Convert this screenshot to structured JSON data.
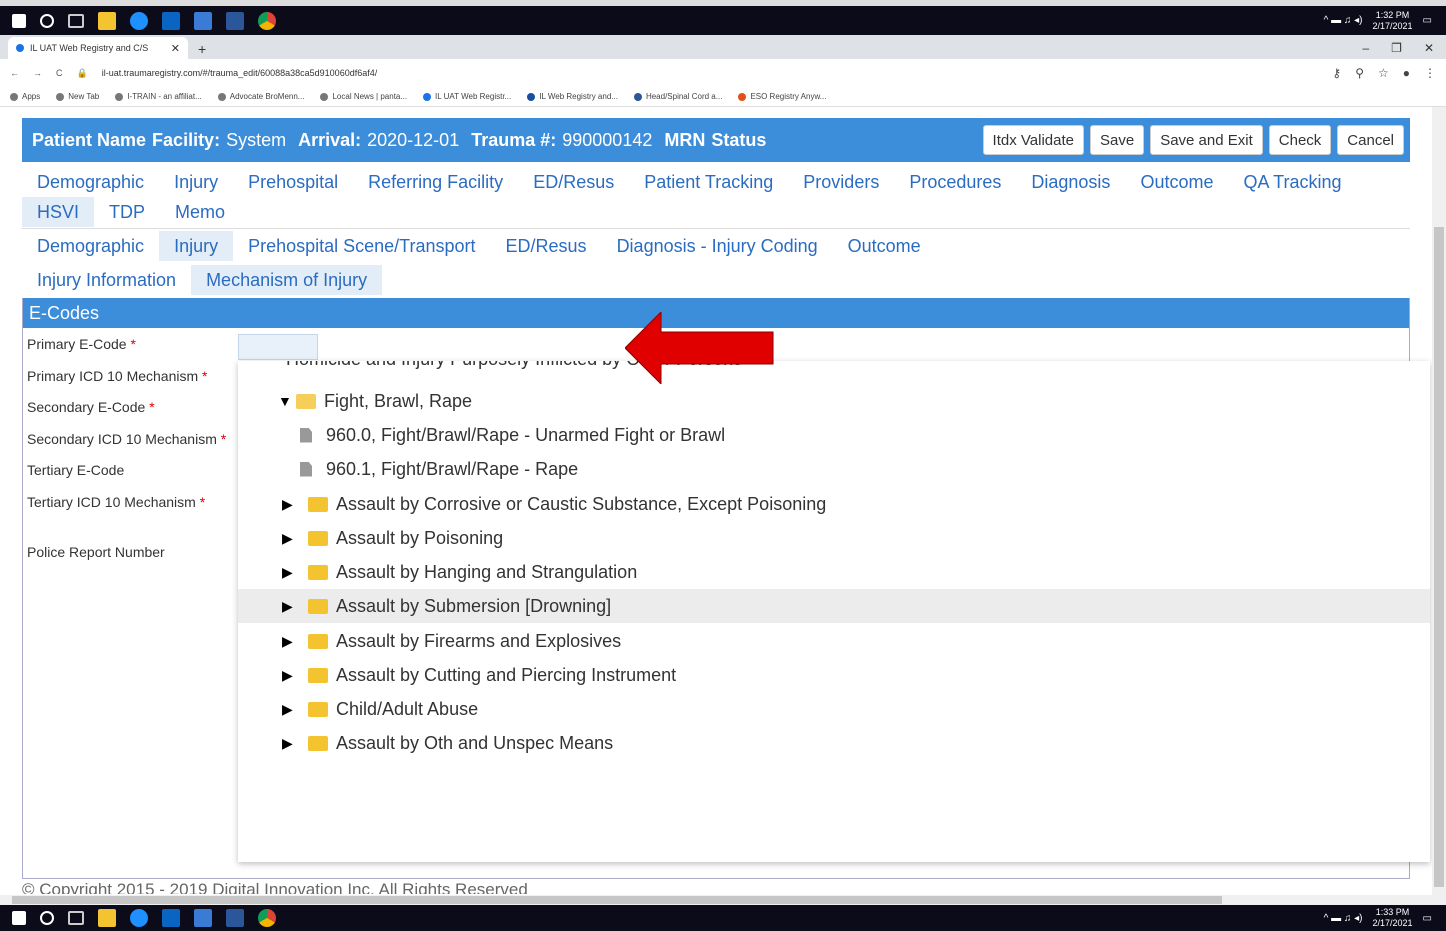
{
  "taskbar_top": {
    "time": "1:32 PM",
    "date": "2/17/2021"
  },
  "taskbar_bottom": {
    "time": "1:33 PM",
    "date": "2/17/2021"
  },
  "browser": {
    "tab_title": "IL UAT Web Registry and C/S",
    "url": "il-uat.traumaregistry.com/#/trauma_edit/60088a38ca5d910060df6af4/",
    "bookmarks": [
      "Apps",
      "New Tab",
      "I-TRAIN - an affiliat...",
      "Advocate BroMenn...",
      "Local News | panta...",
      "IL UAT Web Registr...",
      "IL Web Registry and...",
      "Head/Spinal Cord a...",
      "ESO Registry Anyw..."
    ]
  },
  "header": {
    "patient_name_label": "Patient Name",
    "facility_label": "Facility:",
    "facility_value": "System",
    "arrival_label": "Arrival:",
    "arrival_value": "2020-12-01",
    "trauma_label": "Trauma #:",
    "trauma_value": "990000142",
    "mrn_label": "MRN",
    "status_label": "Status",
    "buttons": [
      "Itdx Validate",
      "Save",
      "Save and Exit",
      "Check",
      "Cancel"
    ]
  },
  "nav1": {
    "row1": [
      "Demographic",
      "Injury",
      "Prehospital",
      "Referring Facility",
      "ED/Resus",
      "Patient Tracking",
      "Providers",
      "Procedures",
      "Diagnosis",
      "Outcome",
      "QA Tracking"
    ],
    "row2": [
      "HSVI",
      "TDP",
      "Memo"
    ]
  },
  "nav2": {
    "row1": [
      "Demographic",
      "Injury",
      "Prehospital Scene/Transport",
      "ED/Resus",
      "Diagnosis - Injury Coding",
      "Outcome"
    ],
    "row2": [
      "Injury Information",
      "Mechanism of Injury"
    ]
  },
  "ecodes": {
    "title": "E-Codes",
    "fields": [
      "Primary E-Code",
      "Primary ICD 10 Mechanism",
      "Secondary E-Code",
      "Secondary ICD 10 Mechanism",
      "Tertiary E-Code",
      "Tertiary ICD 10 Mechanism",
      "Police Report Number"
    ],
    "required_marker": "*"
  },
  "dropdown": {
    "cut_item": "Homicide and Injury Purposely Inflicted by Other Persons",
    "items": [
      "Fight, Brawl, Rape",
      "960.0, Fight/Brawl/Rape - Unarmed Fight or Brawl",
      "960.1, Fight/Brawl/Rape - Rape",
      "Assault by Corrosive or Caustic Substance, Except Poisoning",
      "Assault by Poisoning",
      "Assault by Hanging and Strangulation",
      "Assault by Submersion [Drowning]",
      "Assault by Firearms and Explosives",
      "Assault by Cutting and Piercing Instrument",
      "Child/Adult Abuse",
      "Assault by Oth and Unspec Means"
    ]
  },
  "footer": {
    "copyright": "© Copyright 2015 - 2019 Digital Innovation Inc. All Rights Reserved"
  },
  "colors": {
    "header_blue": "#3c8dda",
    "link_blue": "#2a6cc1",
    "arrow_red": "#e00000"
  }
}
